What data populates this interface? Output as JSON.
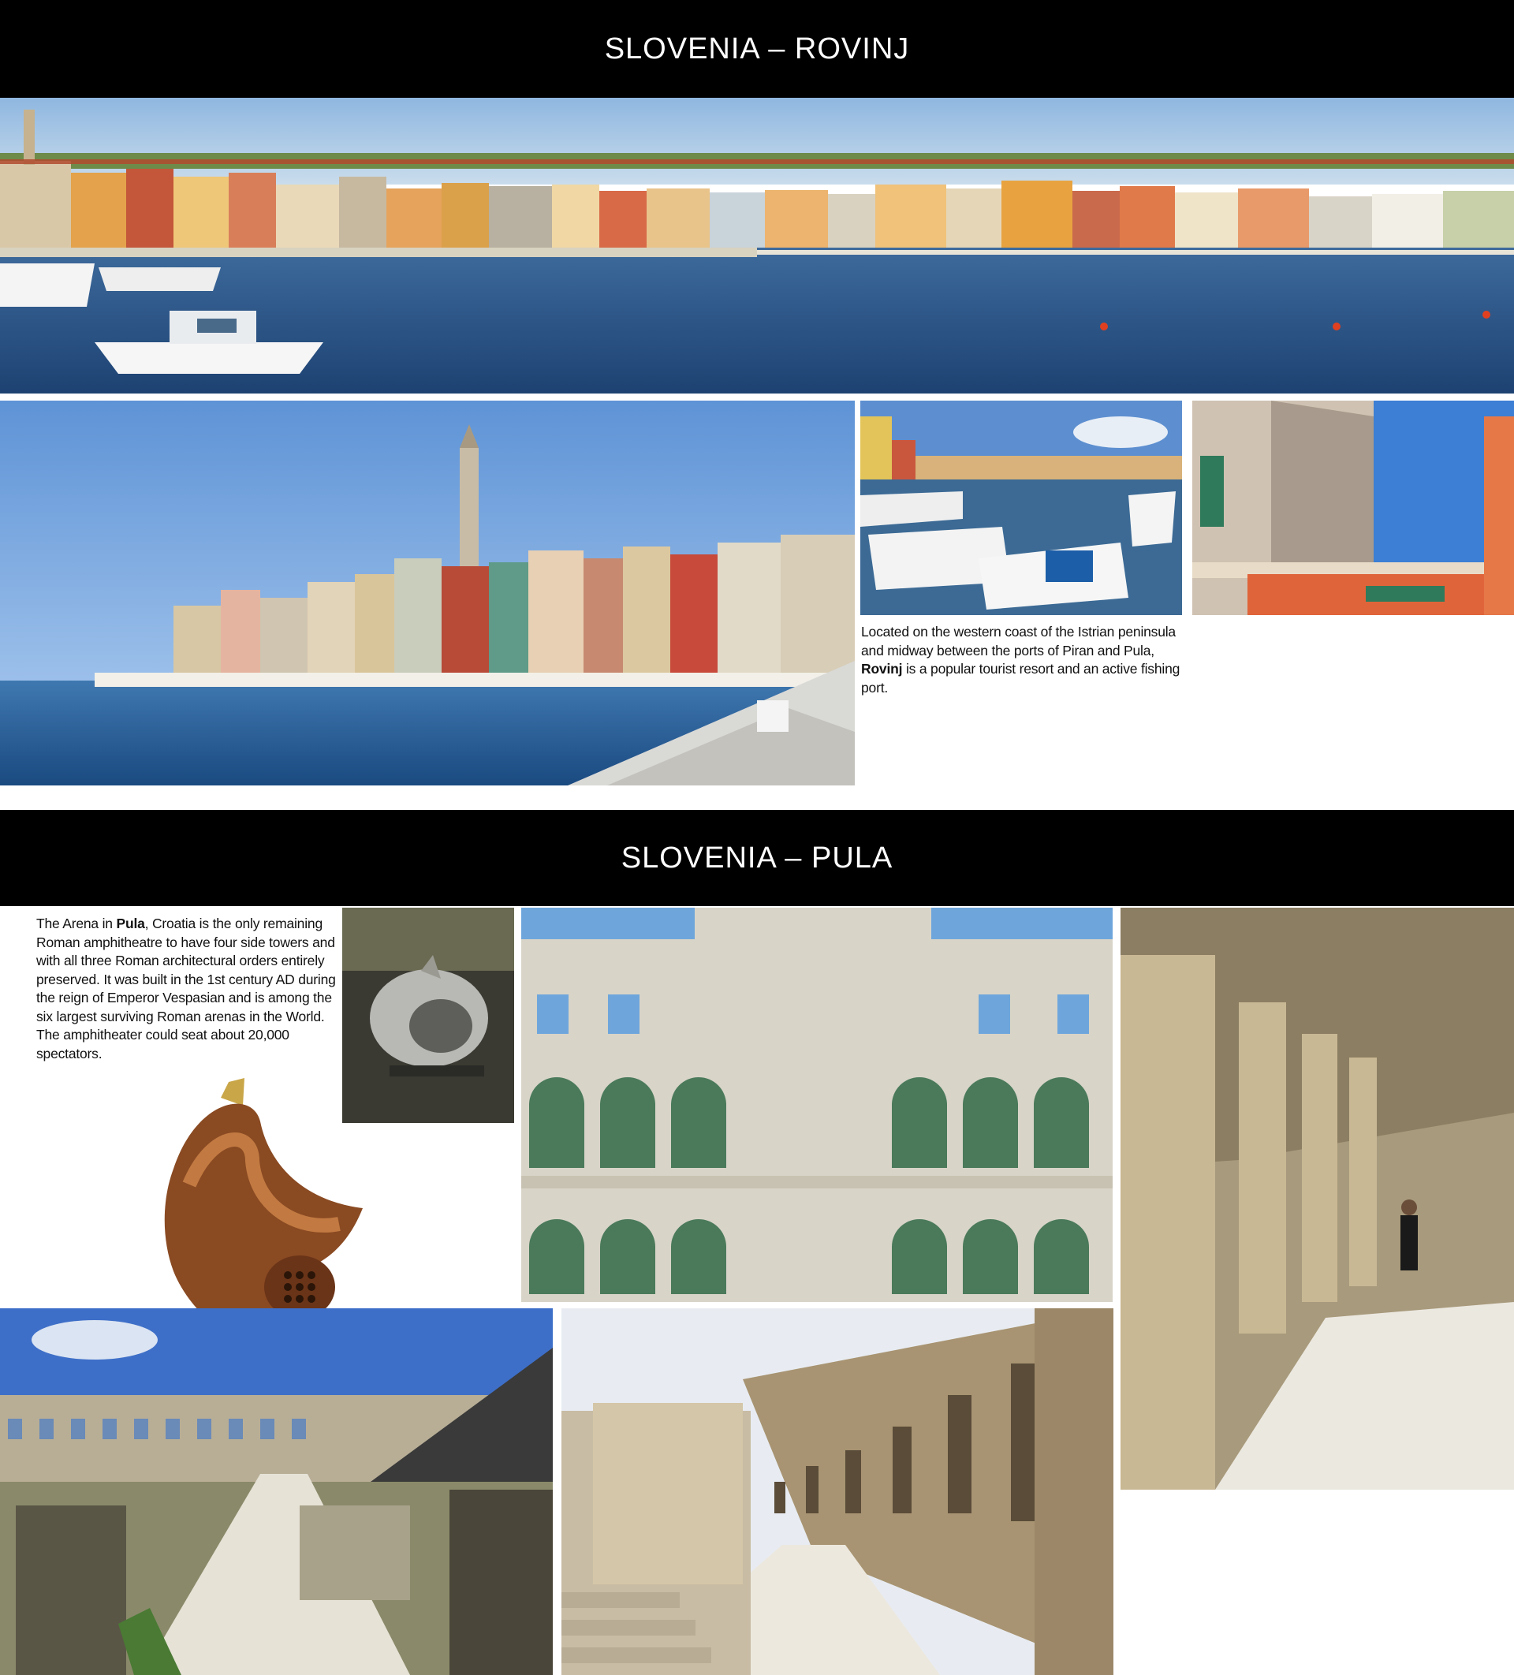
{
  "sections": {
    "rovinj": {
      "title": "SLOVENIA – ROVINJ",
      "caption": {
        "before": "Located on the western coast of the Istrian peninsula and midway between the ports of Piran and Pula, ",
        "place": "Rovinj",
        "after": " is a popular tourist resort and an active fishing port."
      }
    },
    "pula": {
      "title": "SLOVENIA – PULA",
      "caption": {
        "before": "The Arena in ",
        "place": "Pula",
        "after": ", Croatia is the only remaining Roman amphitheatre to have four side towers and with all three Roman architectural orders entirely preserved. It was built in the 1st century AD during the reign of Emperor Vespasian and is among the six largest surviving Roman arenas in the World. The amphitheater could seat about 20,000 spectators."
      }
    }
  },
  "photos": [
    "rovinj-harbour-panorama",
    "rovinj-old-town-peninsula",
    "rovinj-marina-boats",
    "rovinj-rooftop-detail",
    "gladiator-helmet-steel",
    "pula-arena-arches",
    "pula-arena-corridor",
    "gladiator-helmet-bronze",
    "pula-arena-interior",
    "pula-arena-walkway"
  ]
}
